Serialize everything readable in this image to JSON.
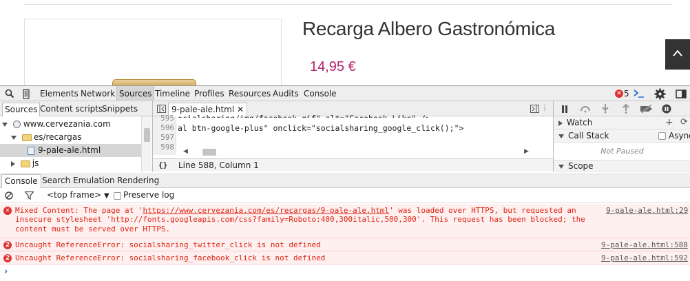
{
  "page": {
    "product_title": "Recarga Albero Gastronómica",
    "price": "14,95 €"
  },
  "devtools": {
    "toolbar": {
      "tabs": [
        "Elements",
        "Network",
        "Sources",
        "Timeline",
        "Profiles",
        "Resources",
        "Audits",
        "Console"
      ],
      "selected_tab": "Sources",
      "error_count": "5"
    },
    "navigator": {
      "tabs": [
        "Sources",
        "Content scripts",
        "Snippets"
      ],
      "tree": [
        {
          "label": "www.cervezania.com",
          "type": "domain"
        },
        {
          "label": "es/recargas",
          "type": "folder"
        },
        {
          "label": "9-pale-ale.html",
          "type": "file",
          "selected": true
        },
        {
          "label": "js",
          "type": "folder"
        }
      ]
    },
    "editor": {
      "file_tab": "9-pale-ale.html",
      "line_numbers": [
        "595",
        "596",
        "597",
        "598"
      ],
      "code_lines": [
        "ocialsharing/img/facebook.gif\" alt=\"Facebook Like\" />",
        "al btn-google-plus\" onclick=\"socialsharing_google_click();\">",
        "",
        ""
      ],
      "status_braces": "{}",
      "cursor_position": "Line 588, Column 1"
    },
    "debugger": {
      "sections": [
        "Watch",
        "Call Stack",
        "Scope"
      ],
      "async_label": "Async",
      "not_paused": "Not Paused"
    },
    "console": {
      "tabs": [
        "Console",
        "Search",
        "Emulation",
        "Rendering"
      ],
      "frame": "<top frame>",
      "preserve_log": "Preserve log",
      "messages": [
        {
          "badge": "",
          "text_prefix": "Mixed Content: The page at '",
          "url": "https://www.cervezania.com/es/recargas/9-pale-ale.html",
          "text_suffix": "' was loaded over HTTPS, but requested an insecure stylesheet 'http://fonts.googleapis.com/css?family=Roboto:400,300italic,500,300'. This request has been blocked; the content must be served over HTTPS.",
          "source": "9-pale-ale.html:29"
        },
        {
          "badge": "2",
          "text": "Uncaught ReferenceError: socialsharing_twitter_click is not defined",
          "source": "9-pale-ale.html:588"
        },
        {
          "badge": "2",
          "text": "Uncaught ReferenceError: socialsharing_facebook_click is not defined",
          "source": "9-pale-ale.html:592"
        }
      ],
      "prompt": "›"
    },
    "colors": {
      "error_text": "#d21",
      "error_bg": "#fff0f0",
      "price": "#b0226a"
    }
  }
}
